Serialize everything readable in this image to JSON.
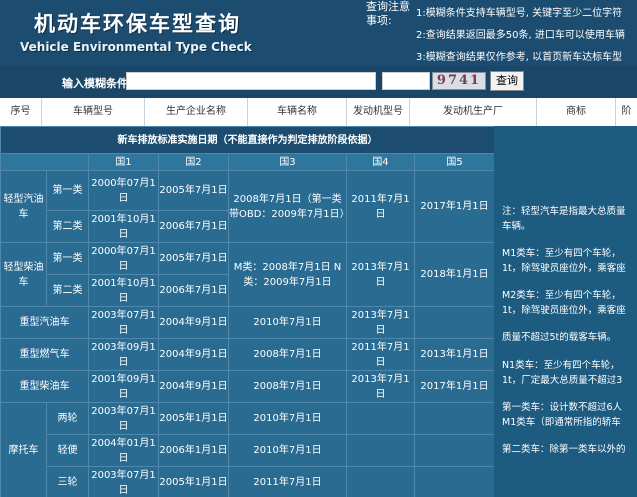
{
  "header": {
    "title_cn": "机动车环保车型查询",
    "title_en": "Vehicle Environmental Type Check",
    "notice_label": "查询注意事项:",
    "notices": [
      "1:模糊条件支持车辆型号, 关键字至少二位字符",
      "2:查询结果返回最多50条, 进口车可以使用车辆",
      "3:模糊查询结果仅作参考, 以首页新车达标车型"
    ]
  },
  "search": {
    "label": "输入模糊条件:",
    "value": "",
    "captcha_value": "",
    "captcha_text": "9741",
    "button_label": "查询"
  },
  "columns": [
    "序号",
    "车辆型号",
    "生产企业名称",
    "车辆名称",
    "发动机型号",
    "发动机生产厂",
    "商标",
    "阶"
  ],
  "standards": {
    "title": "新车排放标准实施日期（不能直接作为判定排放阶段依据）",
    "stages": [
      "国1",
      "国2",
      "国3",
      "国4",
      "国5"
    ],
    "light_gasoline": {
      "label": "轻型汽油车",
      "class1": {
        "label": "第一类",
        "g1": "2000年07月1日",
        "g2": "2005年7月1日",
        "g3": "2008年7月1日（第一类带OBD：2009年7月1日）",
        "g4": "2011年7月1日",
        "g5": "2017年1月1日"
      },
      "class2": {
        "label": "第二类",
        "g1": "2001年10月1日",
        "g2": "2006年7月1日"
      }
    },
    "light_diesel": {
      "label": "轻型柴油车",
      "class1": {
        "label": "第一类",
        "g1": "2000年07月1日",
        "g2": "2005年7月1日",
        "g3": "M类：2008年7月1日 N类：2009年7月1日",
        "g4": "2013年7月1日",
        "g5": "2018年1月1日"
      },
      "class2": {
        "label": "第二类",
        "g1": "2001年10月1日",
        "g2": "2006年7月1日"
      }
    },
    "heavy_gasoline": {
      "label": "重型汽油车",
      "g1": "2003年07月1日",
      "g2": "2004年9月1日",
      "g3": "2010年7月1日",
      "g4": "2013年7月1日",
      "g5": ""
    },
    "heavy_gas": {
      "label": "重型燃气车",
      "g1": "2003年09月1日",
      "g2": "2004年9月1日",
      "g3": "2008年7月1日",
      "g4": "2011年7月1日",
      "g5": "2013年1月1日"
    },
    "heavy_diesel": {
      "label": "重型柴油车",
      "g1": "2001年09月1日",
      "g2": "2004年9月1日",
      "g3": "2008年7月1日",
      "g4": "2013年7月1日",
      "g5": "2017年1月1日"
    },
    "motorcycle": {
      "label": "摩托车",
      "two_wheel": {
        "label": "两轮",
        "g1": "2003年07月1日",
        "g2": "2005年1月1日",
        "g3": "2010年7月1日"
      },
      "light": {
        "label": "轻便",
        "g1": "2004年01月1日",
        "g2": "2006年1月1日",
        "g3": "2010年7月1日"
      },
      "three_wheel": {
        "label": "三轮",
        "g1": "2003年07月1日",
        "g2": "2005年1月1日",
        "g3": "2011年7月1日"
      }
    }
  },
  "notes": {
    "n1a": "注：轻型汽车是指最大总质量",
    "n1b": "车辆。",
    "m1a": "M1类车：至少有四个车轮，",
    "m1b": "1t，除驾驶员座位外，乘客座",
    "m2a": "M2类车：至少有四个车轮，",
    "m2b": "1t，除驾驶员座位外，乘客座",
    "n5": "质量不超过5t的载客车辆。",
    "n1c_a": "N1类车：至少有四个车轮，",
    "n1c_b": "1t，厂定最大总质量不超过3",
    "c1a": "第一类车：设计数不超过6人",
    "c1b": "M1类车（即通常所指的轿车",
    "c2": "第二类车：除第一类车以外的"
  }
}
